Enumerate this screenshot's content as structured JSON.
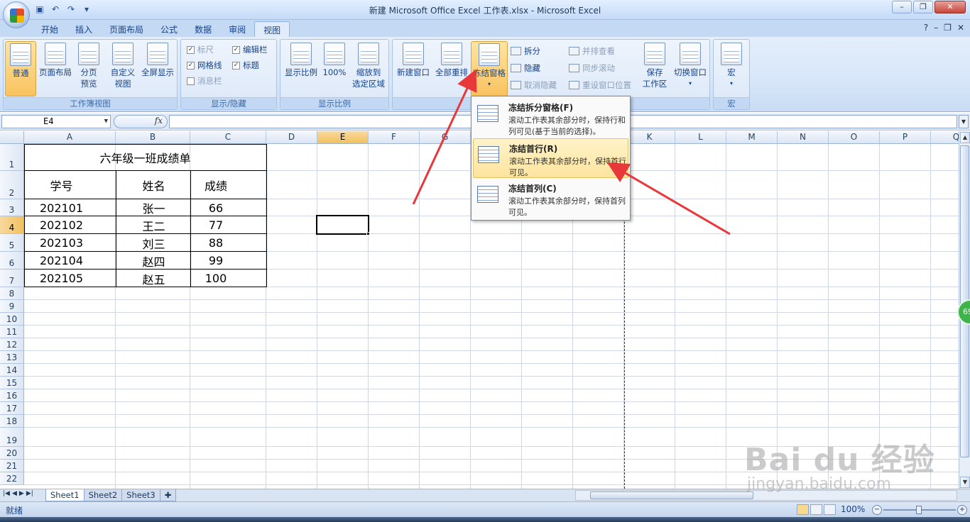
{
  "window": {
    "title": "新建 Microsoft Office Excel 工作表.xlsx - Microsoft Excel",
    "minimize": "–",
    "restore": "❐",
    "close": "✕"
  },
  "ribbon": {
    "tabs": [
      "开始",
      "插入",
      "页面布局",
      "公式",
      "数据",
      "审阅",
      "视图"
    ],
    "active_tab": "视图",
    "right_help": "?",
    "right_min": "–",
    "right_restore": "❐",
    "right_close": "✕",
    "groups": {
      "workbook_views": {
        "label": "工作簿视图",
        "normal": "普通",
        "page_layout": "页面布局",
        "page_break_1": "分页",
        "page_break_2": "预览",
        "custom_1": "自定义",
        "custom_2": "视图",
        "fullscreen": "全屏显示"
      },
      "show_hide": {
        "label": "显示/隐藏",
        "ruler": "标尺",
        "formula_bar": "编辑栏",
        "gridlines": "网格线",
        "headings": "标题",
        "message_bar": "消息栏"
      },
      "zoom": {
        "label": "显示比例",
        "zoom": "显示比例",
        "hundred": "100%",
        "zoom_sel_1": "缩放到",
        "zoom_sel_2": "选定区域"
      },
      "window": {
        "label": "窗口",
        "new_window": "新建窗口",
        "arrange_all": "全部重排",
        "freeze_panes": "冻结窗格",
        "split": "拆分",
        "hide": "隐藏",
        "unhide": "取消隐藏",
        "side_by_side": "并排查看",
        "sync_scroll": "同步滚动",
        "reset_pos": "重设窗口位置",
        "save_ws_1": "保存",
        "save_ws_2": "工作区",
        "switch": "切换窗口"
      },
      "macros": {
        "label": "宏",
        "macros": "宏"
      }
    }
  },
  "formula_bar": {
    "name_box": "E4",
    "fx": "fx"
  },
  "grid": {
    "columns": [
      "A",
      "B",
      "C",
      "D",
      "E",
      "F",
      "G",
      "H",
      "I",
      "J",
      "K",
      "L",
      "M",
      "N",
      "O",
      "P",
      "Q"
    ],
    "rows": [
      "1",
      "2",
      "3",
      "4",
      "5",
      "6",
      "7",
      "8",
      "9",
      "10",
      "11",
      "12",
      "13",
      "14",
      "15",
      "16",
      "17",
      "18",
      "19",
      "20",
      "21",
      "22"
    ],
    "selected_col": "E",
    "selected_row": "4"
  },
  "table": {
    "title": "六年级一班成绩单",
    "headers": [
      "学号",
      "姓名",
      "成绩"
    ],
    "rows": [
      [
        "202101",
        "张一",
        "66"
      ],
      [
        "202102",
        "王二",
        "77"
      ],
      [
        "202103",
        "刘三",
        "88"
      ],
      [
        "202104",
        "赵四",
        "99"
      ],
      [
        "202105",
        "赵五",
        "100"
      ]
    ]
  },
  "dropdown": {
    "items": [
      {
        "title": "冻结拆分窗格(F)",
        "desc": "滚动工作表其余部分时，保持行和列可见(基于当前的选择)。"
      },
      {
        "title": "冻结首行(R)",
        "desc": "滚动工作表其余部分时，保持首行可见。"
      },
      {
        "title": "冻结首列(C)",
        "desc": "滚动工作表其余部分时，保持首列可见。"
      }
    ]
  },
  "sheets": [
    "Sheet1",
    "Sheet2",
    "Sheet3"
  ],
  "active_sheet": "Sheet1",
  "status": {
    "ready": "就绪",
    "zoom": "100%"
  },
  "watermark": {
    "logo": "Bai du 经验",
    "url": "jingyan.baidu.com"
  },
  "badge": "69",
  "colors": {
    "accent": "#15428b",
    "highlight": "#f9c25f",
    "arrow": "#e8383a"
  }
}
